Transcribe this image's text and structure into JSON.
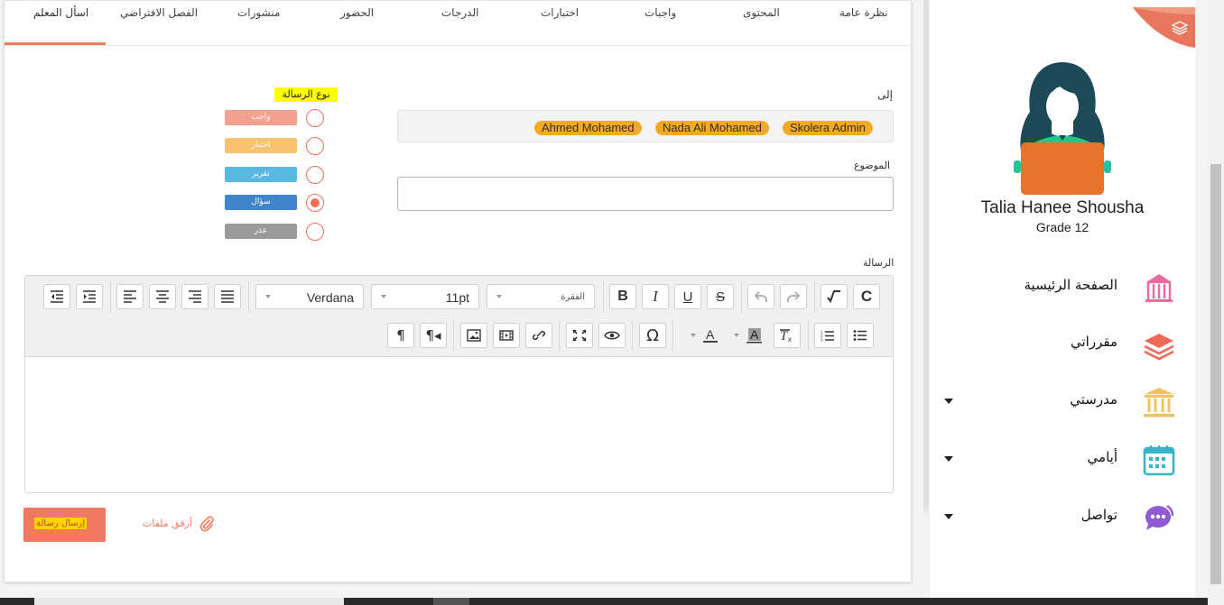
{
  "tabs": [
    {
      "label": "نظرة عامة"
    },
    {
      "label": "المحتوى"
    },
    {
      "label": "واجبات"
    },
    {
      "label": "اختبارات"
    },
    {
      "label": "الدرجات"
    },
    {
      "label": "الحضور"
    },
    {
      "label": "منشورات"
    },
    {
      "label": "الفصل الافتراضي"
    },
    {
      "label": "اسأل المعلم"
    }
  ],
  "compose": {
    "to_label": "إلى",
    "recipients": [
      "Skolera Admin",
      "Nada Ali Mohamed",
      "Ahmed Mohamed"
    ],
    "subject_label": "الموضوع",
    "subject_value": "",
    "message_type_label": "نوع الرسالة",
    "message_types": [
      {
        "label": "واجب",
        "color": "#f4a08f",
        "selected": false
      },
      {
        "label": "اختبار",
        "color": "#f8c36e",
        "selected": false
      },
      {
        "label": "تقرير",
        "color": "#5ab8e0",
        "selected": false
      },
      {
        "label": "سؤال",
        "color": "#3f86cc",
        "selected": true
      },
      {
        "label": "عذر",
        "color": "#9a9a9a",
        "selected": false
      }
    ],
    "message_label": "الرسالة",
    "font_family": "Verdana",
    "font_size": "11pt",
    "paragraph_format": "الفقرة",
    "send_button": "إرسال رسالة",
    "attach_files": "أرفق ملفات"
  },
  "profile": {
    "name": "Talia Hanee Shousha",
    "grade": "Grade 12"
  },
  "nav": [
    {
      "label": "الصفحة الرئيسية",
      "icon": "school-building-icon",
      "color": "#f06aa2",
      "has_dropdown": false
    },
    {
      "label": "مقرراتي",
      "icon": "books-stack-icon",
      "color": "#ee6a5a",
      "has_dropdown": false
    },
    {
      "label": "مدرستي",
      "icon": "institution-icon",
      "color": "#f3c25a",
      "has_dropdown": true
    },
    {
      "label": "أيامي",
      "icon": "calendar-icon",
      "color": "#35b5c9",
      "has_dropdown": true
    },
    {
      "label": "تواصل",
      "icon": "chat-bubble-icon",
      "color": "#8e5bd3",
      "has_dropdown": true
    }
  ],
  "colors": {
    "accent": "#ef7b5f",
    "chip": "#f0aa25",
    "highlight": "#ffff00"
  }
}
